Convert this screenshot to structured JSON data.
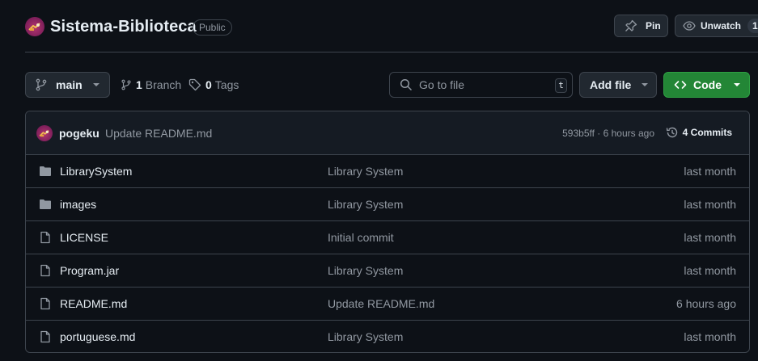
{
  "repo": {
    "name": "Sistema-Biblioteca",
    "visibility": "Public",
    "pin_label": "Pin",
    "watch_label": "Unwatch",
    "watch_count": "1"
  },
  "toolbar": {
    "branch": "main",
    "branches_count": "1",
    "branches_label": "Branch",
    "tags_count": "0",
    "tags_label": "Tags",
    "search_placeholder": "Go to file",
    "search_shortcut": "t",
    "add_file_label": "Add file",
    "code_label": "Code"
  },
  "latest_commit": {
    "author": "pogeku",
    "message": "Update README.md",
    "meta": "593b5ff · 6 hours ago",
    "commits_label": "4 Commits"
  },
  "files": [
    {
      "name": "LibrarySystem",
      "type": "folder",
      "commit": "Library System",
      "date": "last month"
    },
    {
      "name": "images",
      "type": "folder",
      "commit": "Library System",
      "date": "last month"
    },
    {
      "name": "LICENSE",
      "type": "file",
      "commit": "Initial commit",
      "date": "last month"
    },
    {
      "name": "Program.jar",
      "type": "file",
      "commit": "Library System",
      "date": "last month"
    },
    {
      "name": "README.md",
      "type": "file",
      "commit": "Update README.md",
      "date": "6 hours ago"
    },
    {
      "name": "portuguese.md",
      "type": "file",
      "commit": "Library System",
      "date": "last month"
    }
  ],
  "icons": {
    "pin": "pin-icon",
    "watch": "eye-icon",
    "branch": "git-branch-icon",
    "tag": "tag-icon",
    "search": "search-icon",
    "code": "code-icon",
    "history": "history-icon",
    "folder": "folder-icon",
    "file": "file-icon"
  },
  "colors": {
    "background": "#0d1117",
    "border": "#3d444d",
    "button": "#212830",
    "code_button": "#238636",
    "muted_text": "#9198a1",
    "avatar": "#b3366f"
  }
}
